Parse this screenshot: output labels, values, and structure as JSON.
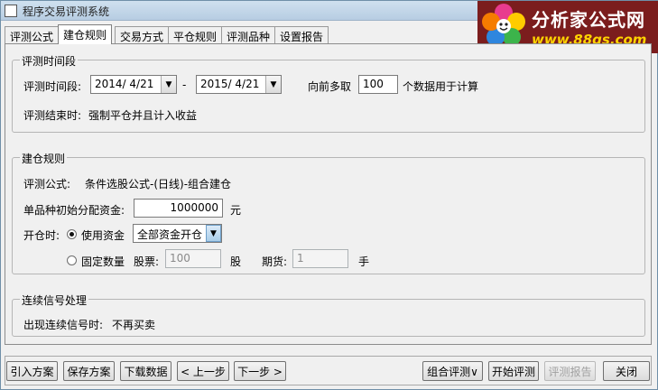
{
  "window": {
    "title": "程序交易评测系统"
  },
  "logo": {
    "name": "分析家公式网",
    "url": "www.88gs.com"
  },
  "tabs": [
    {
      "label": "评测公式"
    },
    {
      "label": "建仓规则",
      "active": true
    },
    {
      "label": "交易方式"
    },
    {
      "label": "平仓规则"
    },
    {
      "label": "评测品种"
    },
    {
      "label": "设置报告"
    }
  ],
  "period": {
    "group_title": "评测时间段",
    "range_label": "评测时间段:",
    "start_date": "2014/ 4/21",
    "dash": "-",
    "end_date": "2015/ 4/21",
    "lookback_prefix": "向前多取",
    "lookback_value": "100",
    "lookback_suffix": "个数据用于计算",
    "end_label": "评测结束时:",
    "end_value": "强制平仓并且计入收益"
  },
  "open_rule": {
    "group_title": "建仓规则",
    "formula_label": "评测公式:",
    "formula_value": "条件选股公式-(日线)-组合建仓",
    "capital_label": "单品种初始分配资金:",
    "capital_value": "1000000",
    "capital_unit": "元",
    "open_label": "开仓时:",
    "use_capital_label": "使用资金",
    "use_capital_option": "全部资金开仓",
    "fixed_qty_label": "固定数量",
    "stock_label": "股票:",
    "stock_value": "100",
    "stock_unit": "股",
    "futures_label": "期货:",
    "futures_value": "1",
    "futures_unit": "手"
  },
  "signal": {
    "group_title": "连续信号处理",
    "label": "出现连续信号时:",
    "value": "不再买卖"
  },
  "buttons": {
    "import": "引入方案",
    "save": "保存方案",
    "download": "下载数据",
    "prev": "< 上一步",
    "next": "下一步 >",
    "combo": "组合评测∨",
    "start": "开始评测",
    "report": "评测报告",
    "close": "关闭"
  },
  "colors": {
    "logo_bg": "#7b1d1d",
    "logo_url": "#ffd400"
  }
}
